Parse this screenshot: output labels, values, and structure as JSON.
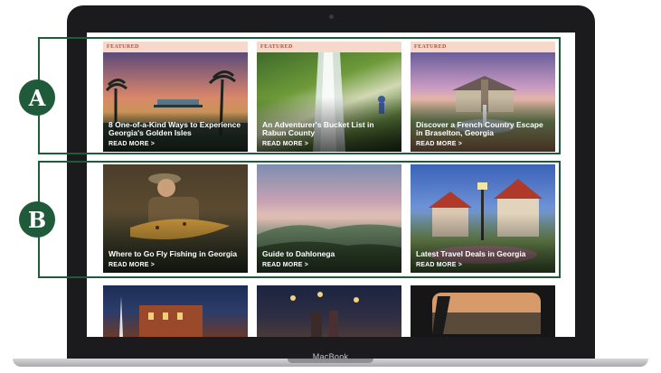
{
  "device": {
    "brand": "MacBook"
  },
  "callouts": {
    "a": "A",
    "b": "B"
  },
  "featured_label": "FEATURED",
  "read_more": "READ MORE >",
  "row_a": [
    {
      "title": "8 One-of-a-Kind Ways to Experience Georgia's Golden Isles"
    },
    {
      "title": "An Adventurer's Bucket List in Rabun County"
    },
    {
      "title": "Discover a French Country Escape in Braselton, Georgia"
    }
  ],
  "row_b": [
    {
      "title": "Where to Go Fly Fishing in Georgia"
    },
    {
      "title": "Guide to Dahlonega"
    },
    {
      "title": "Latest Travel Deals in Georgia"
    }
  ],
  "colors": {
    "callout": "#1f5a3a",
    "featured_bg": "#f7d9cc",
    "featured_text": "#b94a33"
  }
}
